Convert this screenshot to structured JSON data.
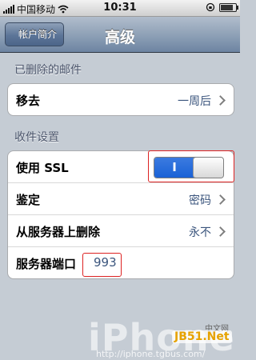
{
  "status_bar": {
    "carrier": "中国移动",
    "time": "10:31"
  },
  "nav": {
    "back_label": "帐户简介",
    "title": "高级"
  },
  "deleted_mail": {
    "header": "已删除的邮件",
    "remove_label": "移去",
    "remove_value": "一周后"
  },
  "incoming": {
    "header": "收件设置",
    "ssl_label": "使用 SSL",
    "ssl_toggle_text": "I",
    "ssl_enabled": true,
    "auth_label": "鉴定",
    "auth_value": "密码",
    "delete_from_server_label": "从服务器上删除",
    "delete_from_server_value": "永不",
    "port_label": "服务器端口",
    "port_value": "993"
  },
  "watermark": {
    "brand": "iPhone",
    "url": "http://iphone.tgbus.com/",
    "site": "JB51.Net",
    "cn": "中文网"
  },
  "colors": {
    "accent_blue": "#1a62d6",
    "value_text": "#3b557d",
    "highlight": "#dd2222"
  }
}
